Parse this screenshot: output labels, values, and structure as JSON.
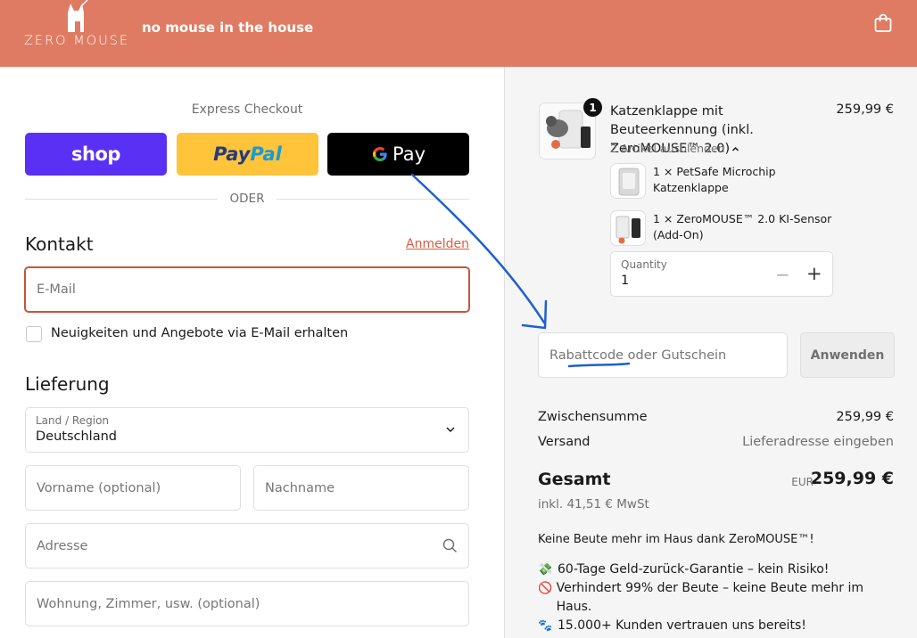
{
  "header": {
    "logo_text": "ZERO MOUSE",
    "tagline": "no mouse in the house",
    "bg_color": "#df7b62"
  },
  "express": {
    "title": "Express Checkout",
    "shop_label": "shop",
    "paypal_label_a": "Pay",
    "paypal_label_b": "Pal",
    "gpay_label": "Pay",
    "divider": "ODER"
  },
  "contact": {
    "heading": "Kontakt",
    "login_link": "Anmelden",
    "email_placeholder": "E-Mail",
    "newsletter_label": "Neuigkeiten und Angebote via E-Mail erhalten"
  },
  "delivery": {
    "heading": "Lieferung",
    "country_label": "Land / Region",
    "country_value": "Deutschland",
    "first_name_placeholder": "Vorname (optional)",
    "last_name_placeholder": "Nachname",
    "address_placeholder": "Adresse",
    "apartment_placeholder": "Wohnung, Zimmer, usw. (optional)"
  },
  "cart": {
    "item_count": "1",
    "product_title": "Katzenklappe mit Beuteerkennung (inkl. ZeroMOUSE™ 2.0)",
    "product_price": "259,99 €",
    "toggle_label": "2 Artikel ausblenden",
    "sub_items": [
      "1 × PetSafe Microchip Katzenklappe",
      "1 × ZeroMOUSE™ 2.0 KI-Sensor (Add-On)"
    ],
    "quantity_label": "Quantity",
    "quantity_value": "1"
  },
  "discount": {
    "placeholder": "Rabattcode oder Gutschein",
    "apply_label": "Anwenden"
  },
  "summary": {
    "subtotal_label": "Zwischensumme",
    "subtotal_value": "259,99 €",
    "shipping_label": "Versand",
    "shipping_value": "Lieferadresse eingeben",
    "total_label": "Gesamt",
    "currency": "EUR",
    "total_value": "259,99 €",
    "tax_note": "inkl. 41,51 € MwSt"
  },
  "promo": {
    "headline": "Keine Beute mehr im Haus dank ZeroMOUSE™!",
    "points": [
      {
        "icon": "money-icon",
        "text": "60-Tage Geld-zurück-Garantie – kein Risiko!"
      },
      {
        "icon": "prohibited-icon",
        "text": "Verhindert 99% der Beute – keine Beute mehr im Haus."
      },
      {
        "icon": "paw-icon",
        "text": "15.000+ Kunden vertrauen uns bereits!"
      }
    ]
  },
  "annotation_color": "#1f5fd0"
}
